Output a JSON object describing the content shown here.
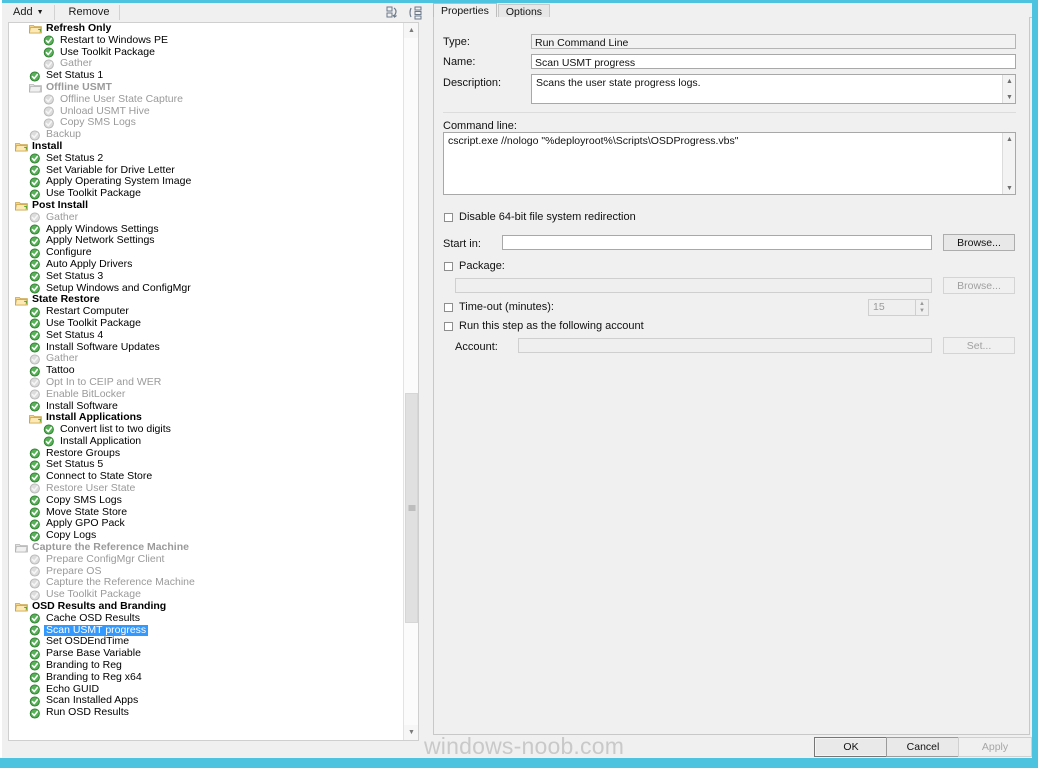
{
  "toolbar": {
    "add_label": "Add",
    "add_caret": "▼",
    "remove_label": "Remove",
    "icon_collapse": "collapse-all-icon",
    "icon_expand": "expand-all-icon"
  },
  "tree": {
    "items": [
      {
        "label": "Refresh Only",
        "indent": 1,
        "icon": "folder",
        "state": "group"
      },
      {
        "label": "Restart to Windows PE",
        "indent": 2,
        "icon": "check",
        "state": "enabled"
      },
      {
        "label": "Use Toolkit Package",
        "indent": 2,
        "icon": "check",
        "state": "enabled"
      },
      {
        "label": "Gather",
        "indent": 2,
        "icon": "check-gray",
        "state": "disabled"
      },
      {
        "label": "Set Status 1",
        "indent": 1,
        "icon": "check",
        "state": "enabled"
      },
      {
        "label": "Offline USMT",
        "indent": 1,
        "icon": "folder-gray",
        "state": "group-disabled"
      },
      {
        "label": "Offline User State Capture",
        "indent": 2,
        "icon": "check-gray",
        "state": "disabled"
      },
      {
        "label": "Unload USMT Hive",
        "indent": 2,
        "icon": "check-gray",
        "state": "disabled"
      },
      {
        "label": "Copy SMS Logs",
        "indent": 2,
        "icon": "check-gray",
        "state": "disabled"
      },
      {
        "label": "Backup",
        "indent": 1,
        "icon": "check-gray",
        "state": "disabled"
      },
      {
        "label": "Install",
        "indent": 0,
        "icon": "folder",
        "state": "group"
      },
      {
        "label": "Set Status 2",
        "indent": 1,
        "icon": "check",
        "state": "enabled"
      },
      {
        "label": "Set Variable for Drive Letter",
        "indent": 1,
        "icon": "check",
        "state": "enabled"
      },
      {
        "label": "Apply Operating System Image",
        "indent": 1,
        "icon": "check",
        "state": "enabled"
      },
      {
        "label": "Use Toolkit Package",
        "indent": 1,
        "icon": "check",
        "state": "enabled"
      },
      {
        "label": "Post Install",
        "indent": 0,
        "icon": "folder",
        "state": "group"
      },
      {
        "label": "Gather",
        "indent": 1,
        "icon": "check-gray",
        "state": "disabled"
      },
      {
        "label": "Apply Windows Settings",
        "indent": 1,
        "icon": "check",
        "state": "enabled"
      },
      {
        "label": "Apply Network Settings",
        "indent": 1,
        "icon": "check",
        "state": "enabled"
      },
      {
        "label": "Configure",
        "indent": 1,
        "icon": "check",
        "state": "enabled"
      },
      {
        "label": "Auto Apply Drivers",
        "indent": 1,
        "icon": "check",
        "state": "enabled"
      },
      {
        "label": "Set Status 3",
        "indent": 1,
        "icon": "check",
        "state": "enabled"
      },
      {
        "label": "Setup Windows and ConfigMgr",
        "indent": 1,
        "icon": "check",
        "state": "enabled"
      },
      {
        "label": "State Restore",
        "indent": 0,
        "icon": "folder",
        "state": "group"
      },
      {
        "label": "Restart Computer",
        "indent": 1,
        "icon": "check",
        "state": "enabled"
      },
      {
        "label": "Use Toolkit Package",
        "indent": 1,
        "icon": "check",
        "state": "enabled"
      },
      {
        "label": "Set Status 4",
        "indent": 1,
        "icon": "check",
        "state": "enabled"
      },
      {
        "label": "Install Software Updates",
        "indent": 1,
        "icon": "check",
        "state": "enabled"
      },
      {
        "label": "Gather",
        "indent": 1,
        "icon": "check-gray",
        "state": "disabled"
      },
      {
        "label": "Tattoo",
        "indent": 1,
        "icon": "check",
        "state": "enabled"
      },
      {
        "label": "Opt In to CEIP and WER",
        "indent": 1,
        "icon": "check-gray",
        "state": "disabled"
      },
      {
        "label": "Enable BitLocker",
        "indent": 1,
        "icon": "check-gray",
        "state": "disabled"
      },
      {
        "label": "Install Software",
        "indent": 1,
        "icon": "check",
        "state": "enabled"
      },
      {
        "label": "Install Applications",
        "indent": 1,
        "icon": "folder",
        "state": "group"
      },
      {
        "label": "Convert list to two digits",
        "indent": 2,
        "icon": "check",
        "state": "enabled"
      },
      {
        "label": "Install Application",
        "indent": 2,
        "icon": "check",
        "state": "enabled"
      },
      {
        "label": "Restore Groups",
        "indent": 1,
        "icon": "check",
        "state": "enabled"
      },
      {
        "label": "Set Status 5",
        "indent": 1,
        "icon": "check",
        "state": "enabled"
      },
      {
        "label": "Connect to State Store",
        "indent": 1,
        "icon": "check",
        "state": "enabled"
      },
      {
        "label": "Restore User State",
        "indent": 1,
        "icon": "check-gray",
        "state": "disabled"
      },
      {
        "label": "Copy SMS Logs",
        "indent": 1,
        "icon": "check",
        "state": "enabled"
      },
      {
        "label": "Move State Store",
        "indent": 1,
        "icon": "check",
        "state": "enabled"
      },
      {
        "label": "Apply GPO Pack",
        "indent": 1,
        "icon": "check",
        "state": "enabled"
      },
      {
        "label": "Copy Logs",
        "indent": 1,
        "icon": "check",
        "state": "enabled"
      },
      {
        "label": "Capture the Reference Machine",
        "indent": 0,
        "icon": "folder-gray",
        "state": "group-disabled"
      },
      {
        "label": "Prepare ConfigMgr Client",
        "indent": 1,
        "icon": "check-gray",
        "state": "disabled"
      },
      {
        "label": "Prepare OS",
        "indent": 1,
        "icon": "check-gray",
        "state": "disabled"
      },
      {
        "label": "Capture the Reference Machine",
        "indent": 1,
        "icon": "check-gray",
        "state": "disabled"
      },
      {
        "label": "Use Toolkit Package",
        "indent": 1,
        "icon": "check-gray",
        "state": "disabled"
      },
      {
        "label": "OSD Results and Branding",
        "indent": 0,
        "icon": "folder",
        "state": "group"
      },
      {
        "label": "Cache OSD Results",
        "indent": 1,
        "icon": "check",
        "state": "enabled"
      },
      {
        "label": "Scan USMT progress",
        "indent": 1,
        "icon": "check",
        "state": "selected"
      },
      {
        "label": "Set OSDEndTime",
        "indent": 1,
        "icon": "check",
        "state": "enabled"
      },
      {
        "label": "Parse Base Variable",
        "indent": 1,
        "icon": "check",
        "state": "enabled"
      },
      {
        "label": "Branding to Reg",
        "indent": 1,
        "icon": "check",
        "state": "enabled"
      },
      {
        "label": "Branding to Reg x64",
        "indent": 1,
        "icon": "check",
        "state": "enabled"
      },
      {
        "label": "Echo GUID",
        "indent": 1,
        "icon": "check",
        "state": "enabled"
      },
      {
        "label": "Scan Installed Apps",
        "indent": 1,
        "icon": "check",
        "state": "enabled"
      },
      {
        "label": "Run OSD Results",
        "indent": 1,
        "icon": "check",
        "state": "enabled"
      }
    ]
  },
  "tabs": [
    {
      "label": "Properties",
      "active": true
    },
    {
      "label": "Options",
      "active": false
    }
  ],
  "properties": {
    "type_label": "Type:",
    "type_value": "Run Command Line",
    "name_label": "Name:",
    "name_value": "Scan USMT progress",
    "description_label": "Description:",
    "description_value": "Scans the user state progress logs.",
    "command_line_label": "Command line:",
    "command_line_value": "cscript.exe //nologo \"%deployroot%\\Scripts\\OSDProgress.vbs\"",
    "disable_redirection_label": "Disable 64-bit file system redirection",
    "start_in_label": "Start in:",
    "start_in_value": "",
    "start_in_browse": "Browse...",
    "package_label": "Package:",
    "package_value": "",
    "package_browse": "Browse...",
    "timeout_label": "Time-out (minutes):",
    "timeout_value": "15",
    "run_as_label": "Run this step as the following account",
    "account_label": "Account:",
    "account_value": "",
    "account_set": "Set..."
  },
  "footer": {
    "watermark": "windows-noob.com",
    "ok": "OK",
    "cancel": "Cancel",
    "apply": "Apply"
  },
  "colors": {
    "selection": "#3399ff",
    "frame": "#4ec3e0",
    "green_check": "#3faa3f"
  }
}
